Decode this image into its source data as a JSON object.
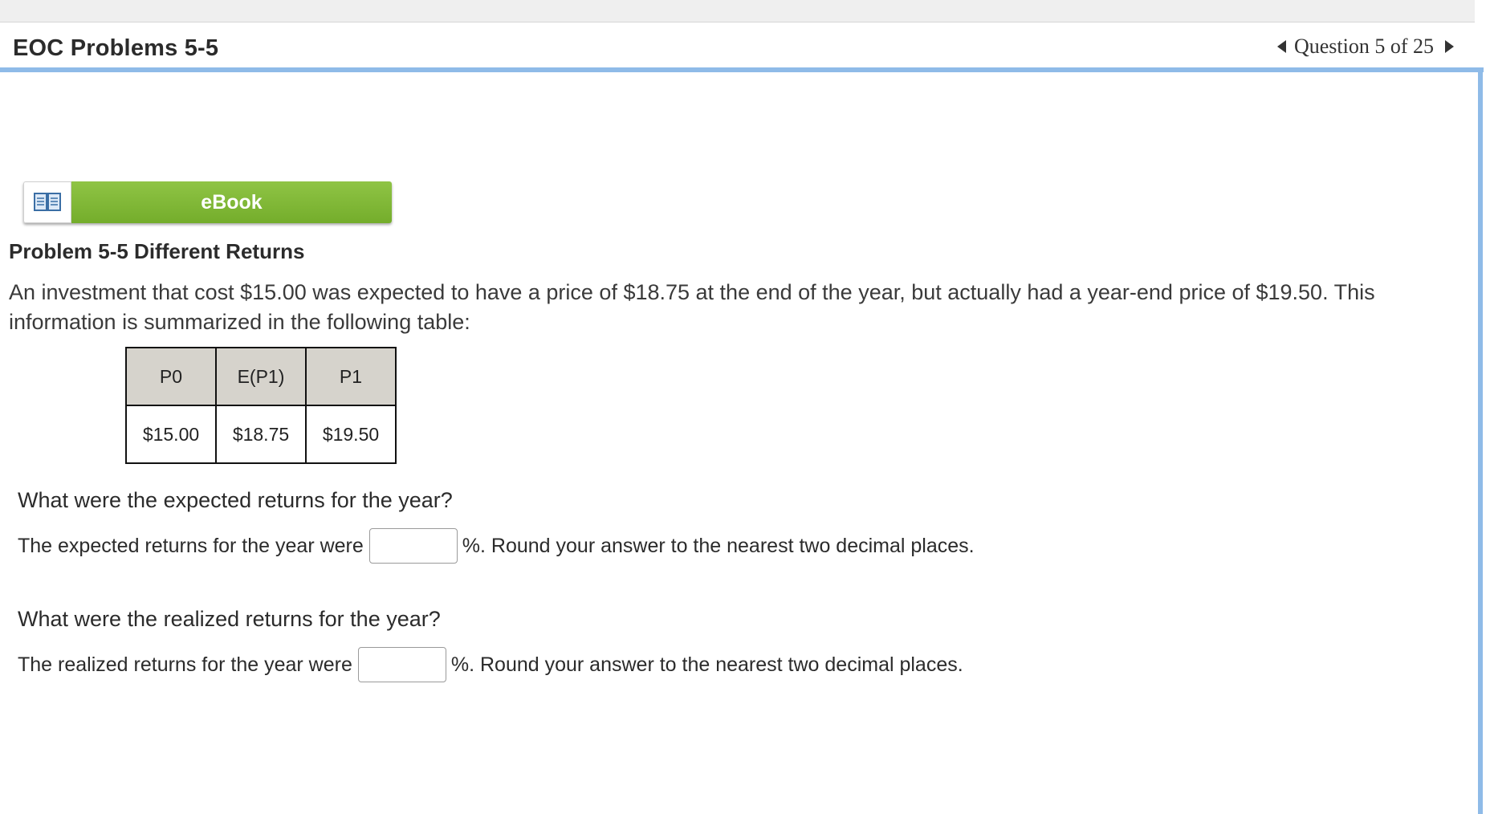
{
  "header": {
    "title": "EOC Problems 5-5",
    "question_nav": "Question 5 of 25"
  },
  "ebook": {
    "label": "eBook",
    "icon": "book-icon"
  },
  "problem": {
    "title": "Problem 5-5 Different Returns",
    "text": "An investment that cost $15.00 was expected to have a price of $18.75 at the end of the year, but actually had a year-end price of $19.50. This information is summarized in the following table:"
  },
  "table": {
    "headers": [
      "P0",
      "E(P1)",
      "P1"
    ],
    "values": [
      "$15.00",
      "$18.75",
      "$19.50"
    ]
  },
  "questions": [
    {
      "heading": "What were the expected returns for the year?",
      "prefix": "The expected returns for the year were",
      "value": "",
      "suffix": "%. Round your answer to the nearest two decimal places."
    },
    {
      "heading": "What were the realized returns for the year?",
      "prefix": "The realized returns for the year were",
      "value": "",
      "suffix": "%. Round your answer to the nearest two decimal places."
    }
  ],
  "colors": {
    "accent_blue": "#8fbbe8",
    "ebook_green": "#7ab534",
    "table_header_bg": "#d6d3cc"
  }
}
